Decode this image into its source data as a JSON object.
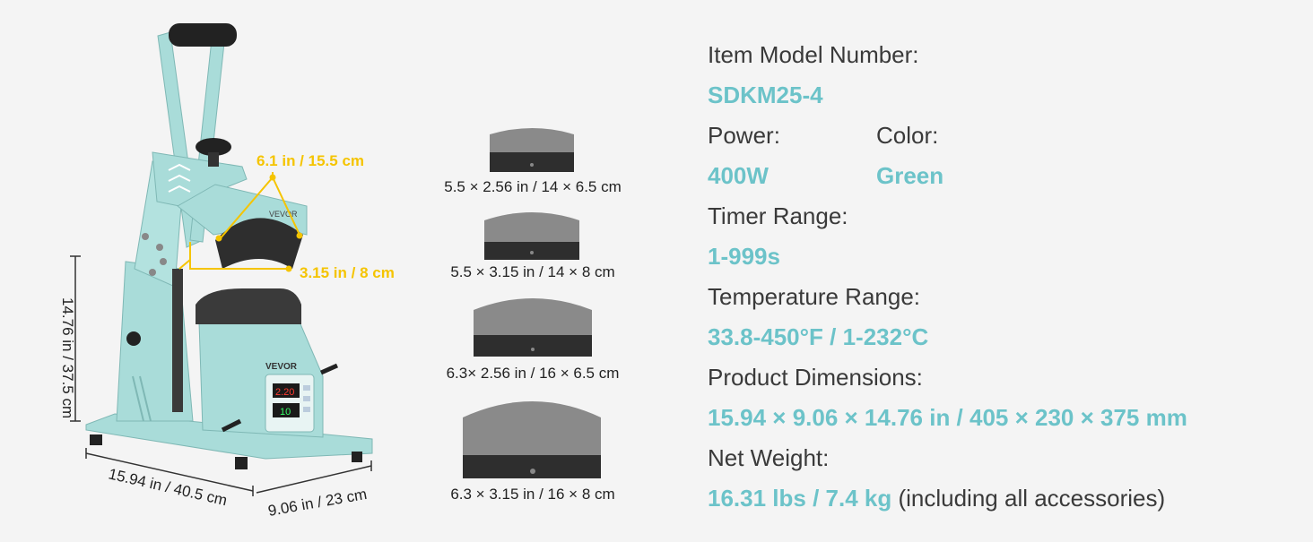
{
  "machine": {
    "brand": "VEVOR",
    "display_top": "2.20",
    "display_bottom": "10",
    "dims": {
      "arc_width": "6.1 in / 15.5 cm",
      "arc_depth": "3.15 in / 8 cm",
      "height": "14.76 in / 37.5 cm",
      "length": "15.94 in / 40.5 cm",
      "width": "9.06 in / 23 cm"
    }
  },
  "plates": [
    {
      "label": "5.5 × 2.56 in / 14 × 6.5 cm"
    },
    {
      "label": "5.5 × 3.15 in / 14 × 8 cm"
    },
    {
      "label": "6.3× 2.56 in / 16 × 6.5 cm"
    },
    {
      "label": "6.3 × 3.15 in / 16 × 8 cm"
    }
  ],
  "specs": {
    "model_label": "Item Model Number:",
    "model_value": "SDKM25-4",
    "power_label": "Power:",
    "power_value": "400W",
    "color_label": "Color:",
    "color_value": "Green",
    "timer_label": "Timer Range:",
    "timer_value": "1-999s",
    "temp_label": "Temperature Range:",
    "temp_value": "33.8-450°F / 1-232°C",
    "dims_label": "Product Dimensions:",
    "dims_value": "15.94 × 9.06 × 14.76 in / 405 × 230 × 375 mm",
    "weight_label": "Net Weight:",
    "weight_value": "16.31 lbs / 7.4 kg",
    "weight_note": "(including all accessories)"
  },
  "colors": {
    "machine_teal": "#a9dcd9",
    "accent_teal": "#6cc3c9",
    "dim_yellow": "#f5c400",
    "platen_gray": "#555555"
  }
}
